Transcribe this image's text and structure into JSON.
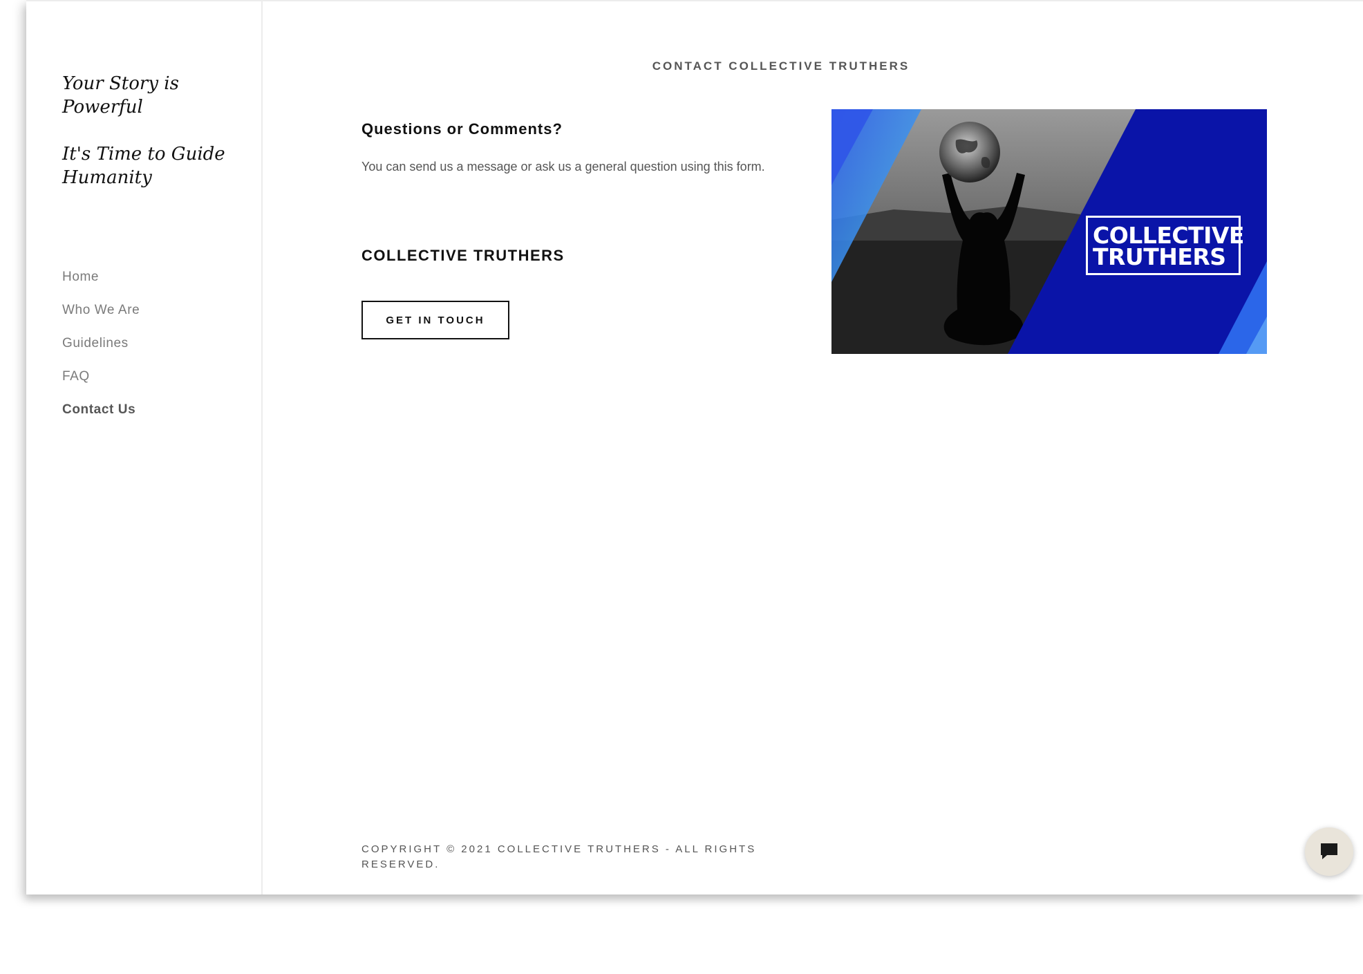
{
  "sidebar": {
    "tagline_1": "Your Story is Powerful",
    "tagline_2": "It's Time to Guide Humanity",
    "nav": [
      {
        "label": "Home",
        "active": false
      },
      {
        "label": "Who We Are",
        "active": false
      },
      {
        "label": "Guidelines",
        "active": false
      },
      {
        "label": "FAQ",
        "active": false
      },
      {
        "label": "Contact Us",
        "active": true
      }
    ]
  },
  "main": {
    "page_heading": "CONTACT COLLECTIVE TRUTHERS",
    "questions_heading": "Questions or Comments?",
    "questions_text": "You can send us a message or ask us a general question using this form.",
    "org_name": "COLLECTIVE TRUTHERS",
    "cta_label": "GET IN TOUCH",
    "hero_image": {
      "brand_line_1": "COLLECTIVE",
      "brand_line_2": "TRUTHERS"
    },
    "copyright": "COPYRIGHT © 2021 COLLECTIVE TRUTHERS - ALL RIGHTS RESERVED."
  },
  "chat": {
    "icon": "chat-bubble-icon"
  },
  "colors": {
    "brand_blue": "#0a14a8",
    "accent_blue": "#2f6ff0",
    "nav_text": "#7a7a7a",
    "chat_bg": "#e9e4da"
  }
}
